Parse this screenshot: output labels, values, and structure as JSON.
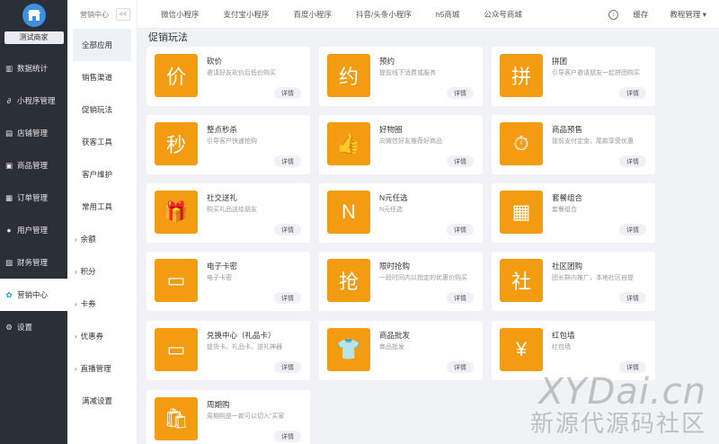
{
  "brand": {
    "name": "测试商家"
  },
  "sidebar": {
    "items": [
      {
        "label": "数据统计",
        "icon": "bar-chart-icon"
      },
      {
        "label": "小程序管理",
        "icon": "mini-program-icon"
      },
      {
        "label": "店铺管理",
        "icon": "shop-icon"
      },
      {
        "label": "商品管理",
        "icon": "goods-icon"
      },
      {
        "label": "订单管理",
        "icon": "order-icon"
      },
      {
        "label": "用户管理",
        "icon": "user-icon"
      },
      {
        "label": "财务管理",
        "icon": "finance-icon"
      },
      {
        "label": "营销中心",
        "icon": "marketing-icon",
        "active": true
      },
      {
        "label": "设置",
        "icon": "settings-icon"
      }
    ]
  },
  "submenu": {
    "title": "营销中心",
    "collapse": "<<",
    "items": [
      {
        "label": "全部应用",
        "selected": true
      },
      {
        "label": "销售渠道"
      },
      {
        "label": "促销玩法"
      },
      {
        "label": "获客工具"
      },
      {
        "label": "客户维护"
      },
      {
        "label": "常用工具"
      },
      {
        "label": "余额",
        "expand": true
      },
      {
        "label": "积分",
        "expand": true
      },
      {
        "label": "卡券",
        "expand": true
      },
      {
        "label": "优惠券",
        "expand": true
      },
      {
        "label": "直播管理",
        "expand": true
      },
      {
        "label": "满减设置"
      }
    ]
  },
  "topbar": {
    "tabs": [
      "微信小程序",
      "支付宝小程序",
      "百度小程序",
      "抖音/头条小程序",
      "h5商城",
      "公众号商城"
    ],
    "cache": "缓存",
    "user": "教程管理",
    "user_caret": "▾"
  },
  "section": {
    "title": "促销玩法"
  },
  "cards": [
    {
      "title": "砍价",
      "desc": "邀请好友砍价后低价购买",
      "btn": "详情",
      "glyph": "价",
      "icon": "bargain-icon"
    },
    {
      "title": "预约",
      "desc": "提前线下消费或服务",
      "btn": "详情",
      "glyph": "约",
      "icon": "reservation-icon"
    },
    {
      "title": "拼团",
      "desc": "引导客户邀请朋友一起拼团购买",
      "btn": "详情",
      "glyph": "拼",
      "icon": "group-buy-icon"
    },
    {
      "title": "整点秒杀",
      "desc": "引导客户快速抢购",
      "btn": "详情",
      "glyph": "秒",
      "icon": "flash-sale-icon"
    },
    {
      "title": "好物圈",
      "desc": "向微信好友推荐好商品",
      "btn": "详情",
      "glyph": "👍",
      "icon": "thumbs-up-icon"
    },
    {
      "title": "商品预售",
      "desc": "提前支付定金，尾款享受优惠",
      "btn": "详情",
      "glyph": "⏱",
      "icon": "presale-icon"
    },
    {
      "title": "社交送礼",
      "desc": "购买礼品送给朋友",
      "btn": "详情",
      "glyph": "🎁",
      "icon": "gift-icon"
    },
    {
      "title": "N元任选",
      "desc": "N元任选",
      "btn": "详情",
      "glyph": "N",
      "icon": "n-yuan-icon"
    },
    {
      "title": "套餐组合",
      "desc": "套餐组合",
      "btn": "详情",
      "glyph": "▦",
      "icon": "combo-icon"
    },
    {
      "title": "电子卡密",
      "desc": "电子卡密",
      "btn": "详情",
      "glyph": "▭",
      "icon": "e-card-icon"
    },
    {
      "title": "限时抢购",
      "desc": "一段时间内以指定的优惠价购买",
      "btn": "详情",
      "glyph": "抢",
      "icon": "limited-time-icon"
    },
    {
      "title": "社区团购",
      "desc": "团长群内推广，本地社区自提",
      "btn": "详情",
      "glyph": "社",
      "icon": "community-icon"
    },
    {
      "title": "兑换中心（礼品卡）",
      "desc": "提货卡、礼品卡、送礼神器",
      "btn": "详情",
      "glyph": "▭",
      "icon": "gift-card-icon"
    },
    {
      "title": "商品批发",
      "desc": "商品批发",
      "btn": "详情",
      "glyph": "👕",
      "icon": "wholesale-icon"
    },
    {
      "title": "红包墙",
      "desc": "红包墙",
      "btn": "详情",
      "glyph": "¥",
      "icon": "red-packet-icon"
    },
    {
      "title": "周期购",
      "desc": "周期购是一款可以切入“买家",
      "btn": "详情",
      "glyph": "🛍",
      "icon": "subscription-icon"
    }
  ],
  "watermark": {
    "line1": "XYDai.cn",
    "line2": "新源代源码社区"
  },
  "colors": {
    "accent": "#f39c12",
    "sidebar_bg": "#2b2f38"
  }
}
